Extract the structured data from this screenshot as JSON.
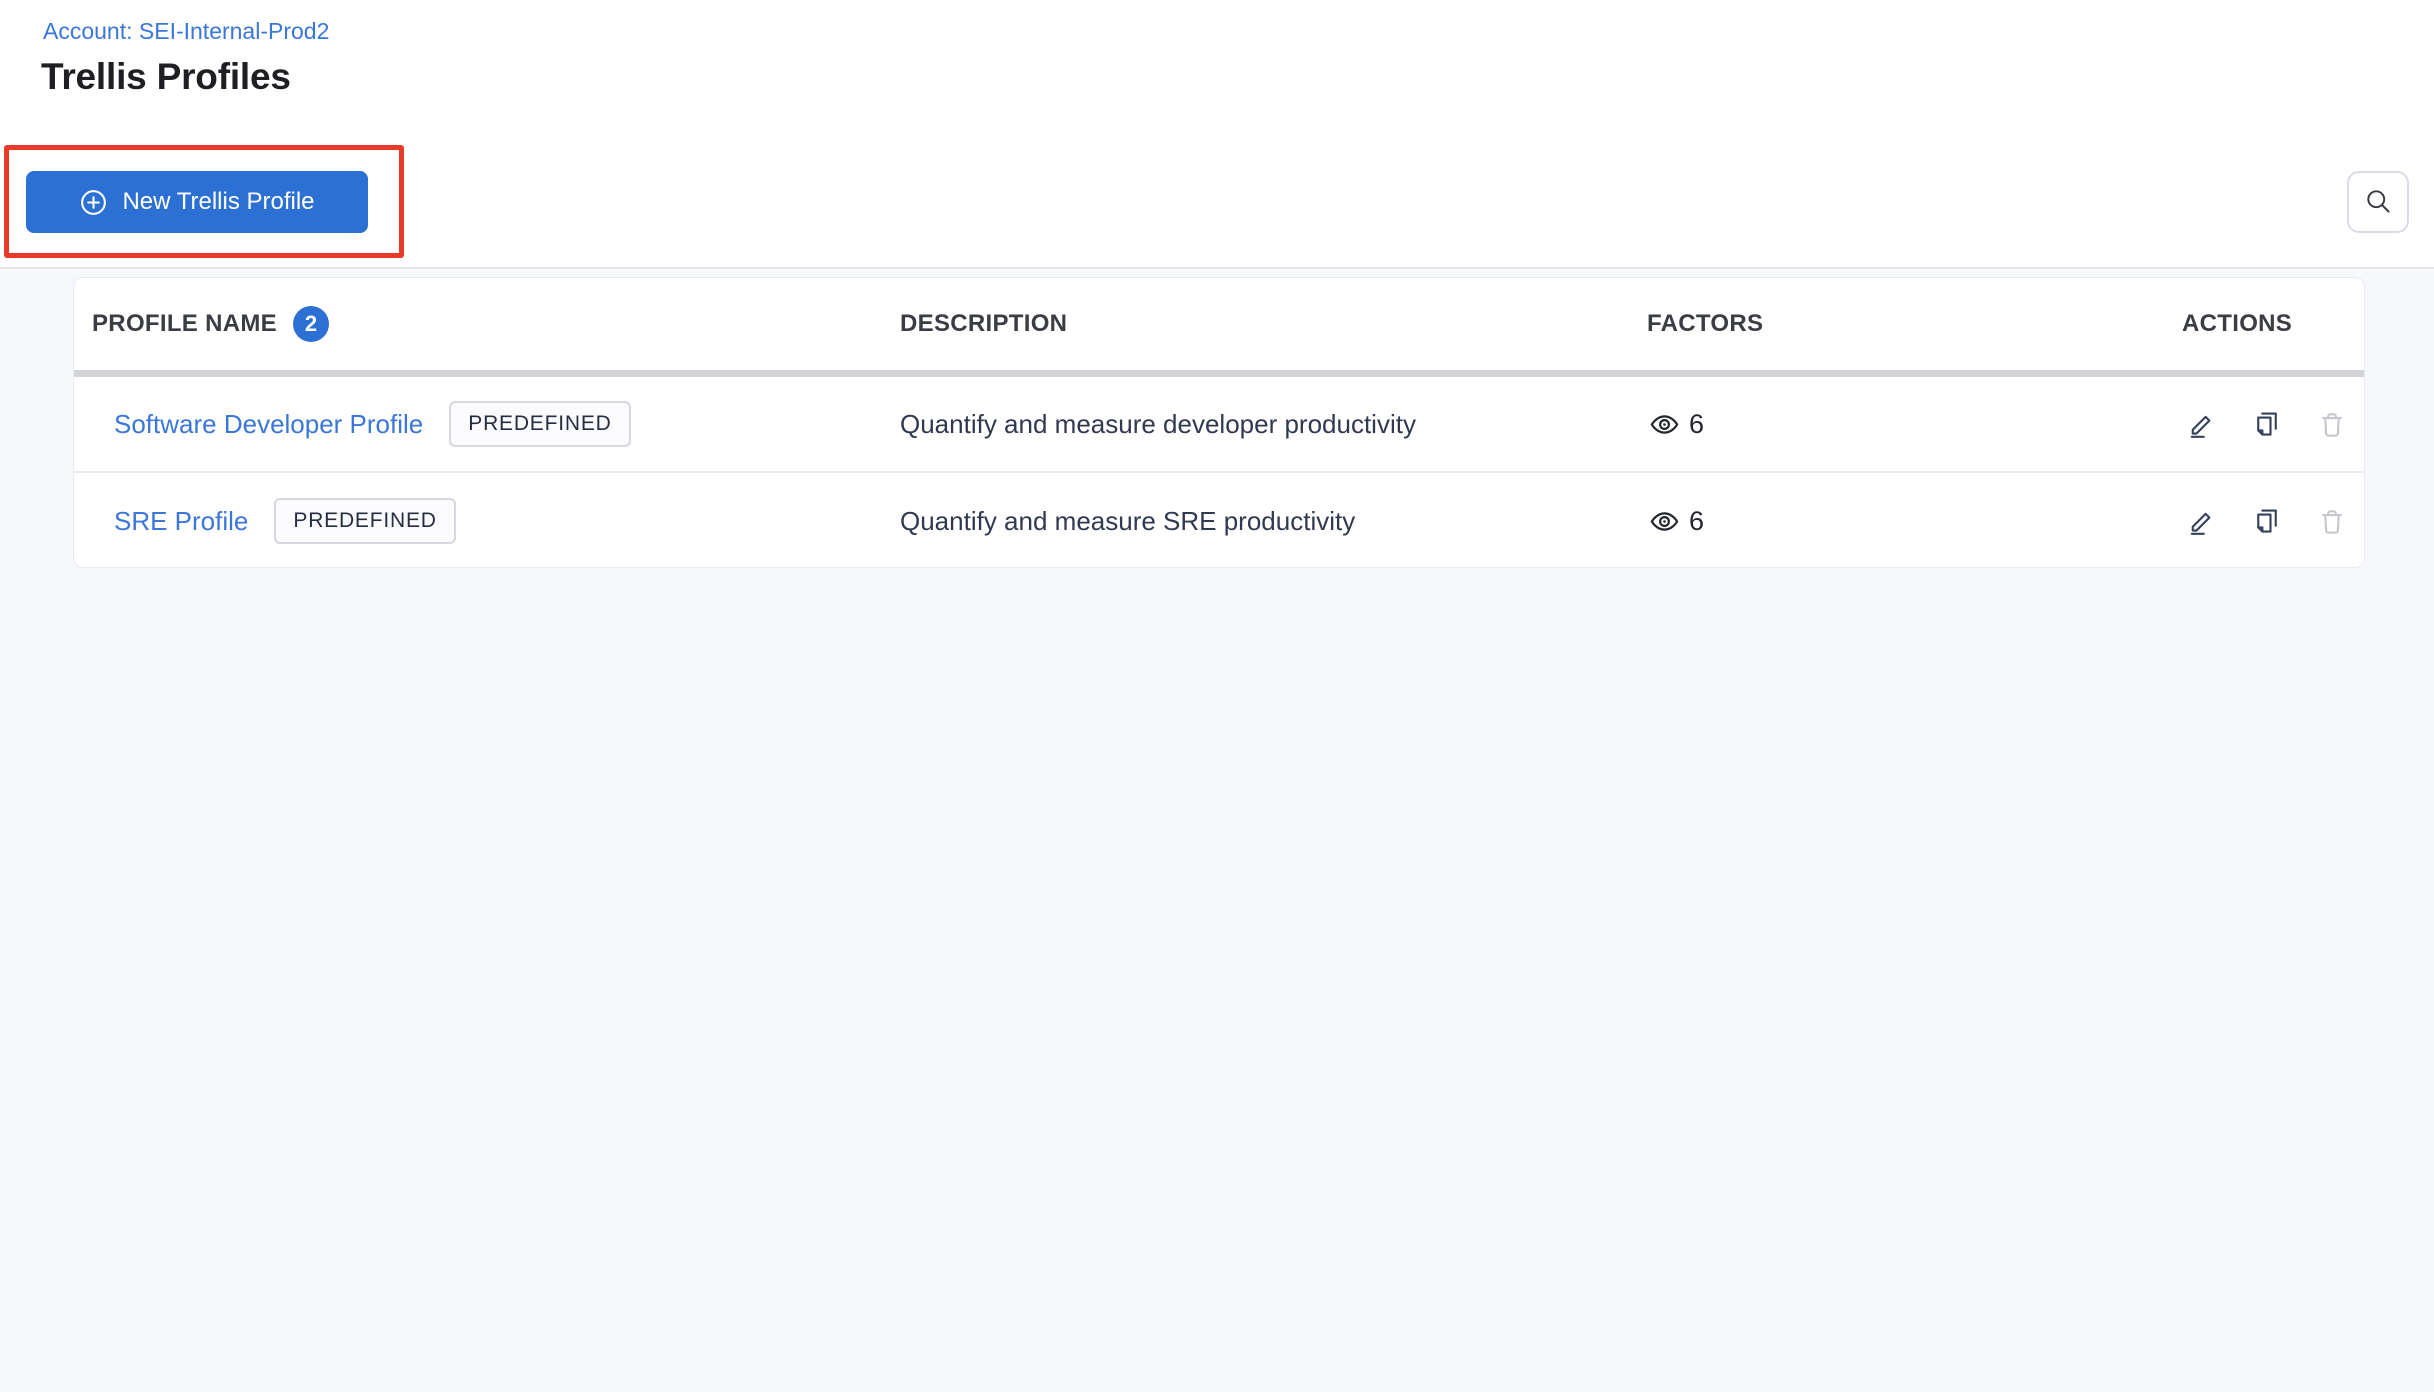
{
  "page": {
    "account_link": "Account: SEI-Internal-Prod2",
    "title": "Trellis Profiles"
  },
  "toolbar": {
    "new_profile_button_label": "New Trellis Profile"
  },
  "table": {
    "headers": {
      "profile_name": "PROFILE NAME",
      "profile_count": "2",
      "description": "DESCRIPTION",
      "factors": "FACTORS",
      "actions": "ACTIONS"
    },
    "rows": [
      {
        "name": "Software Developer Profile",
        "tag": "PREDEFINED",
        "description": "Quantify and measure developer productivity",
        "factors_count": "6"
      },
      {
        "name": "SRE Profile",
        "tag": "PREDEFINED",
        "description": "Quantify and measure SRE productivity",
        "factors_count": "6"
      }
    ]
  },
  "colors": {
    "primary_blue": "#2d70d3",
    "link_blue": "#3b76d9",
    "annotation_red": "#e8392b",
    "icon_dark": "#35405a",
    "disabled_gray": "#c6c8cd",
    "content_background": "#f6f8fc"
  },
  "icons": {
    "new_profile": "plus-circle-icon",
    "search": "search-icon",
    "factors": "eye-icon",
    "edit": "edit-pencil-icon",
    "clone": "copy-icon",
    "delete": "trash-icon"
  }
}
